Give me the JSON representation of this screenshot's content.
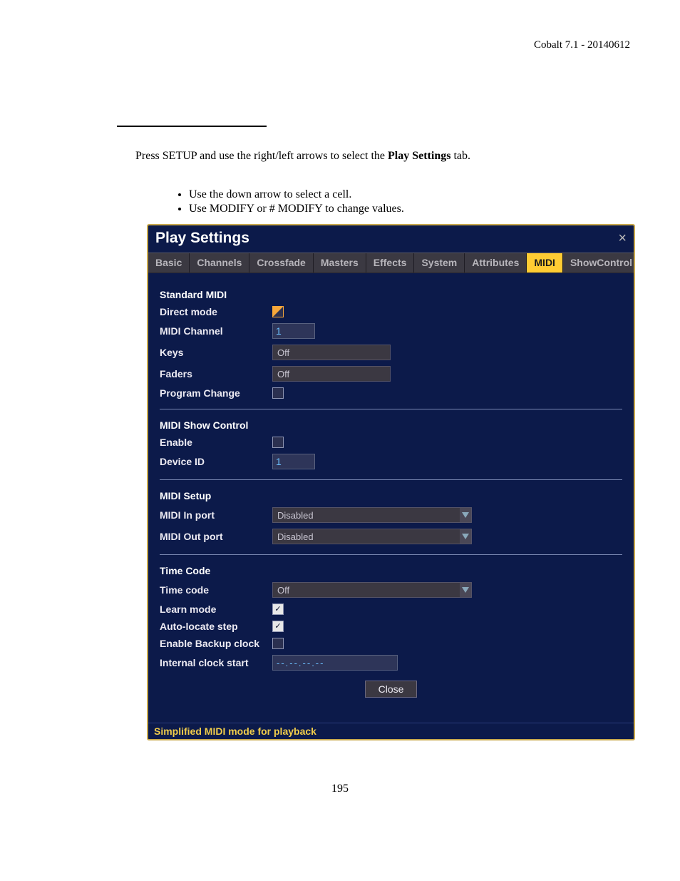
{
  "doc": {
    "header": "Cobalt 7.1 - 20140612",
    "page_number": "195",
    "section_title": "Play Settings - MIDI"
  },
  "instruction": {
    "full": "Press SETUP and use the right/left arrows to select the Play Settings tab.",
    "bullets": [
      "Use the down arrow to select a cell.",
      "Use MODIFY or # MODIFY to change values."
    ]
  },
  "win": {
    "title": "Play Settings",
    "close_icon": "×",
    "tabs": [
      "Basic",
      "Channels",
      "Crossfade",
      "Masters",
      "Effects",
      "System",
      "Attributes",
      "MIDI",
      "ShowControl"
    ],
    "active_tab": "MIDI",
    "groups": {
      "standard_midi": {
        "header": "Standard MIDI",
        "direct_mode_label": "Direct mode",
        "direct_mode_checked": "half",
        "midi_channel_label": "MIDI Channel",
        "midi_channel_value": "1",
        "keys_label": "Keys",
        "keys_value": "Off",
        "faders_label": "Faders",
        "faders_value": "Off",
        "program_change_label": "Program Change",
        "program_change_checked": false
      },
      "msc": {
        "header": "MIDI Show Control",
        "enable_label": "Enable",
        "enable_checked": false,
        "device_id_label": "Device ID",
        "device_id_value": "1"
      },
      "setup": {
        "header": "MIDI Setup",
        "in_label": "MIDI In port",
        "in_value": "Disabled",
        "out_label": "MIDI Out port",
        "out_value": "Disabled"
      },
      "timecode": {
        "header": "Time Code",
        "tc_label": "Time code",
        "tc_value": "Off",
        "learn_label": "Learn mode",
        "learn_checked": true,
        "auto_label": "Auto-locate step",
        "auto_checked": true,
        "backup_label": "Enable Backup clock",
        "backup_checked": false,
        "ics_label": "Internal clock start",
        "ics_value": "--.--.--.--"
      }
    },
    "close_button": "Close",
    "status": "Simplified MIDI mode for playback"
  }
}
